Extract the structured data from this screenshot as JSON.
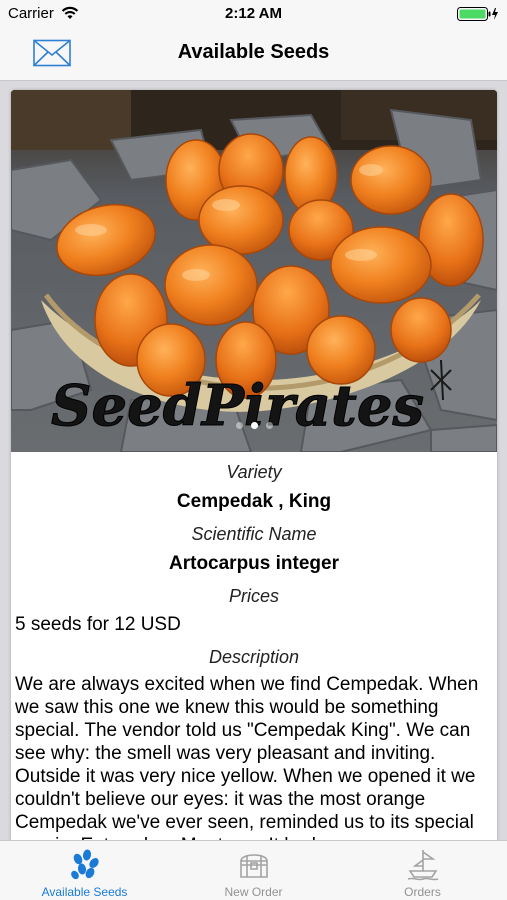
{
  "status_bar": {
    "carrier": "Carrier",
    "time": "2:12 AM"
  },
  "nav": {
    "title": "Available Seeds",
    "left_icon": "mail-icon"
  },
  "image": {
    "watermark": "SeedPirates",
    "slide_count": 3,
    "active_slide": 1
  },
  "details": {
    "variety_label": "Variety",
    "variety_value": "Cempedak , King",
    "scientific_label": "Scientific Name",
    "scientific_value": "Artocarpus integer",
    "prices_label": "Prices",
    "prices_value": "5 seeds for 12 USD",
    "description_label": "Description",
    "description_text": "We are always excited when we find Cempedak. When we saw this one we knew this would be something special. The vendor told us \"Cempedak King\". We can see why: the smell was very pleasant and inviting. Outside it was very nice yellow. When we opened it we couldn't believe our eyes: it was the most orange Cempedak we've ever seen, reminded us to its special cousin, Entawak or Mentawa. It had"
  },
  "tabs": [
    {
      "label": "Available Seeds",
      "icon": "seeds-icon",
      "active": true
    },
    {
      "label": "New Order",
      "icon": "chest-icon",
      "active": false
    },
    {
      "label": "Orders",
      "icon": "ship-icon",
      "active": false
    }
  ],
  "colors": {
    "accent": "#1a7ad6",
    "inactive": "#929292",
    "bar_background": "#f7f7f7"
  }
}
